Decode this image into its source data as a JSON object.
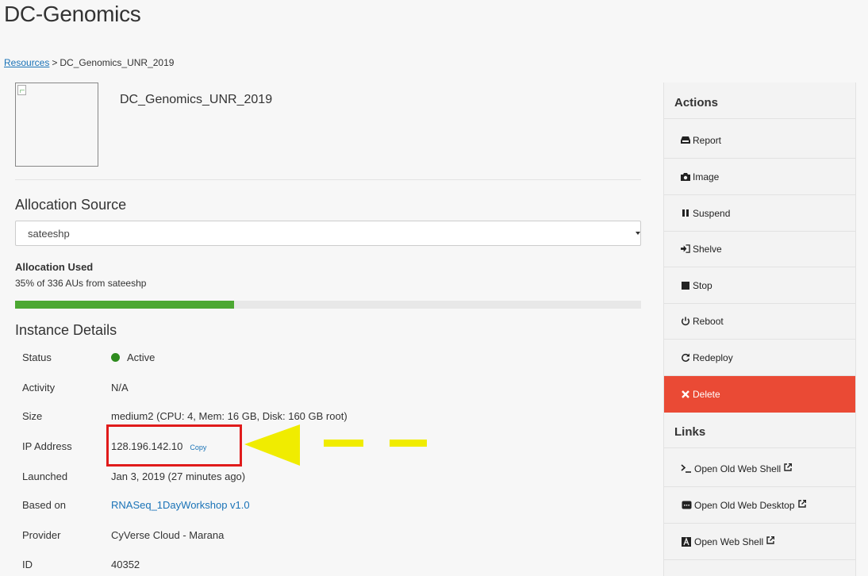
{
  "page": {
    "title": "DC-Genomics"
  },
  "breadcrumb": {
    "link": "Resources",
    "separator": ">",
    "current": "DC_Genomics_UNR_2019"
  },
  "instance": {
    "name": "DC_Genomics_UNR_2019"
  },
  "allocation": {
    "heading": "Allocation Source",
    "selected": "sateeshp",
    "used_label": "Allocation Used",
    "used_text": "35% of 336 AUs from sateeshp",
    "used_fraction": 0.35,
    "bar_color": "#4ca832"
  },
  "details": {
    "heading": "Instance Details",
    "rows": [
      {
        "key": "Status",
        "value": "Active"
      },
      {
        "key": "Activity",
        "value": "N/A"
      },
      {
        "key": "Size",
        "value": "medium2 (CPU: 4, Mem: 16 GB, Disk: 160 GB root)"
      },
      {
        "key": "IP Address",
        "value": "128.196.142.10",
        "extra": "Copy"
      },
      {
        "key": "Launched",
        "value": "Jan 3, 2019 (27 minutes ago)"
      },
      {
        "key": "Based on",
        "value": "RNASeq_1DayWorkshop v1.0"
      },
      {
        "key": "Provider",
        "value": "CyVerse Cloud - Marana"
      },
      {
        "key": "ID",
        "value": "40352"
      }
    ],
    "status_color": "#2e8b1e"
  },
  "sidebar": {
    "actions_heading": "Actions",
    "actions": [
      {
        "label": "Report",
        "icon": "inbox-icon"
      },
      {
        "label": "Image",
        "icon": "camera-icon"
      },
      {
        "label": "Suspend",
        "icon": "pause-icon"
      },
      {
        "label": "Shelve",
        "icon": "sign-in-icon"
      },
      {
        "label": "Stop",
        "icon": "stop-icon"
      },
      {
        "label": "Reboot",
        "icon": "power-icon"
      },
      {
        "label": "Redeploy",
        "icon": "redo-icon"
      },
      {
        "label": "Delete",
        "icon": "times-icon"
      }
    ],
    "links_heading": "Links",
    "links": [
      {
        "label": "Open Old Web Shell",
        "icon": "terminal-icon"
      },
      {
        "label": "Open Old Web Desktop",
        "icon": "desktop-icon"
      },
      {
        "label": "Open Web Shell",
        "icon": "web-shell-icon"
      }
    ],
    "delete_color": "#ea4a35"
  },
  "annotation": {
    "highlight_color": "#e01b1b",
    "arrow_color": "#f0ec00"
  }
}
